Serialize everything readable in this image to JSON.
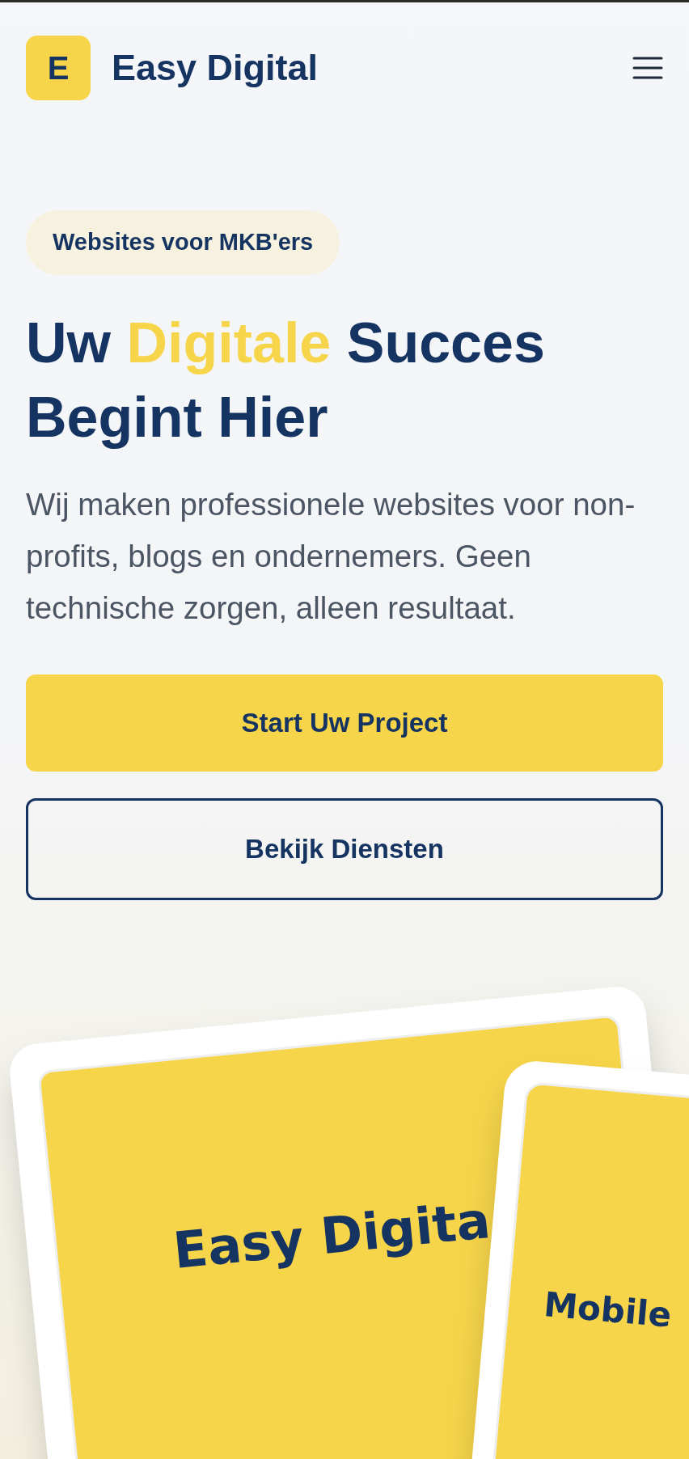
{
  "header": {
    "logo_letter": "E",
    "brand": "Easy Digital"
  },
  "hero": {
    "badge": "Websites voor MKB'ers",
    "heading": [
      {
        "text": "Uw ",
        "highlight": false
      },
      {
        "text": "Digitale",
        "highlight": true
      },
      {
        "text": " Succes Begint Hier",
        "highlight": false
      }
    ],
    "description": "Wij maken professionele websites voor non-profits, blogs en ondernemers. Geen technische zorgen, alleen resultaat.",
    "buttons": [
      {
        "label": "Start Uw Project",
        "kind": "primary"
      },
      {
        "label": "Bekijk Diensten",
        "kind": "outline"
      }
    ]
  },
  "mockups": [
    {
      "kind": "tablet",
      "text": "Easy Digita"
    },
    {
      "kind": "phone",
      "text": "Mobile"
    }
  ]
}
